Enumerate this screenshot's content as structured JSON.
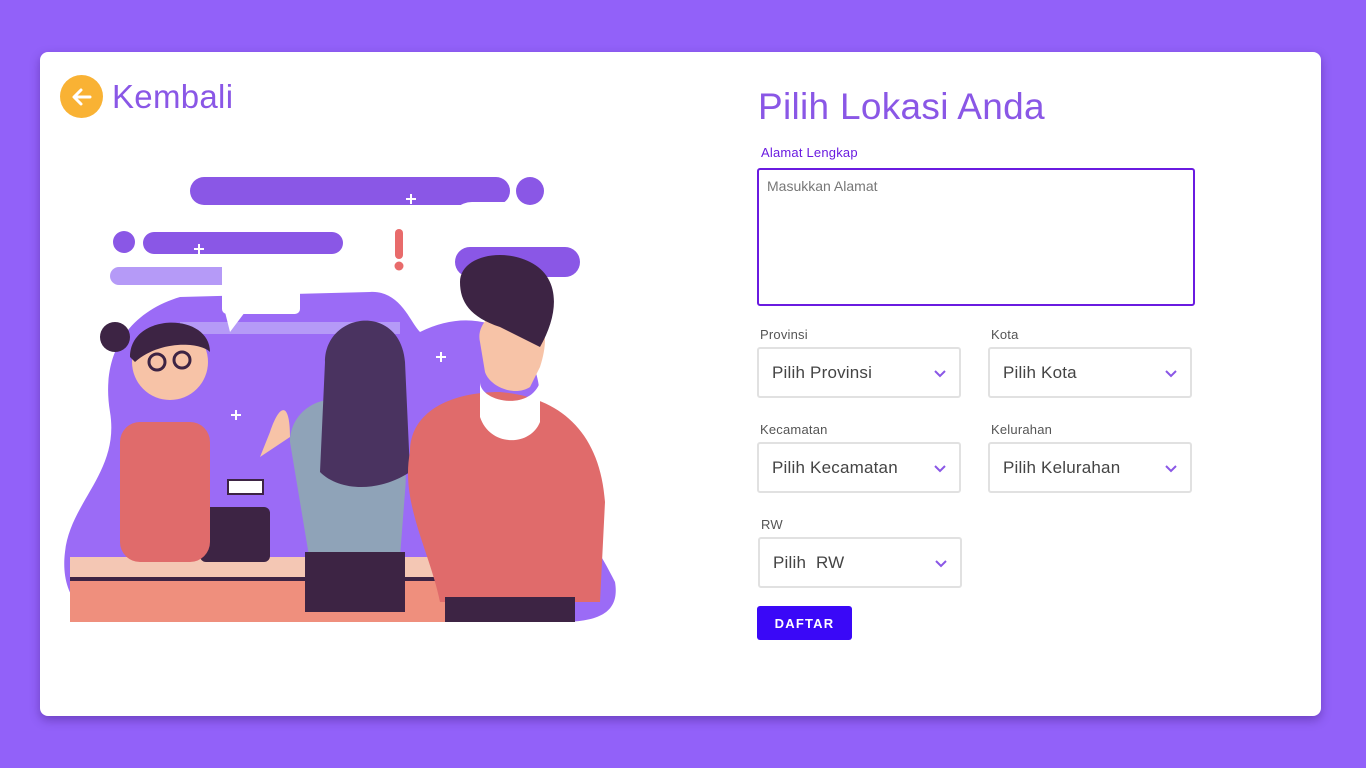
{
  "header": {
    "back_label": "Kembali"
  },
  "form": {
    "title": "Pilih Lokasi Anda",
    "address": {
      "label": "Alamat Lengkap",
      "placeholder": "Masukkan Alamat"
    },
    "provinsi": {
      "label": "Provinsi",
      "value": "Pilih Provinsi"
    },
    "kota": {
      "label": "Kota",
      "value": "Pilih Kota"
    },
    "kecamatan": {
      "label": "Kecamatan",
      "value": "Pilih Kecamatan"
    },
    "kelurahan": {
      "label": "Kelurahan",
      "value": "Pilih Kelurahan"
    },
    "rw": {
      "label": "RW",
      "value": "Pilih  RW"
    },
    "submit_label": "DAFTAR"
  },
  "colors": {
    "background": "#9261f9",
    "accent": "#8a57e6",
    "focus": "#6a1be0",
    "button": "#3a08f7",
    "back_icon": "#f9b234"
  },
  "icons": {
    "back": "arrow-left-icon",
    "dropdown": "chevron-down-icon"
  }
}
